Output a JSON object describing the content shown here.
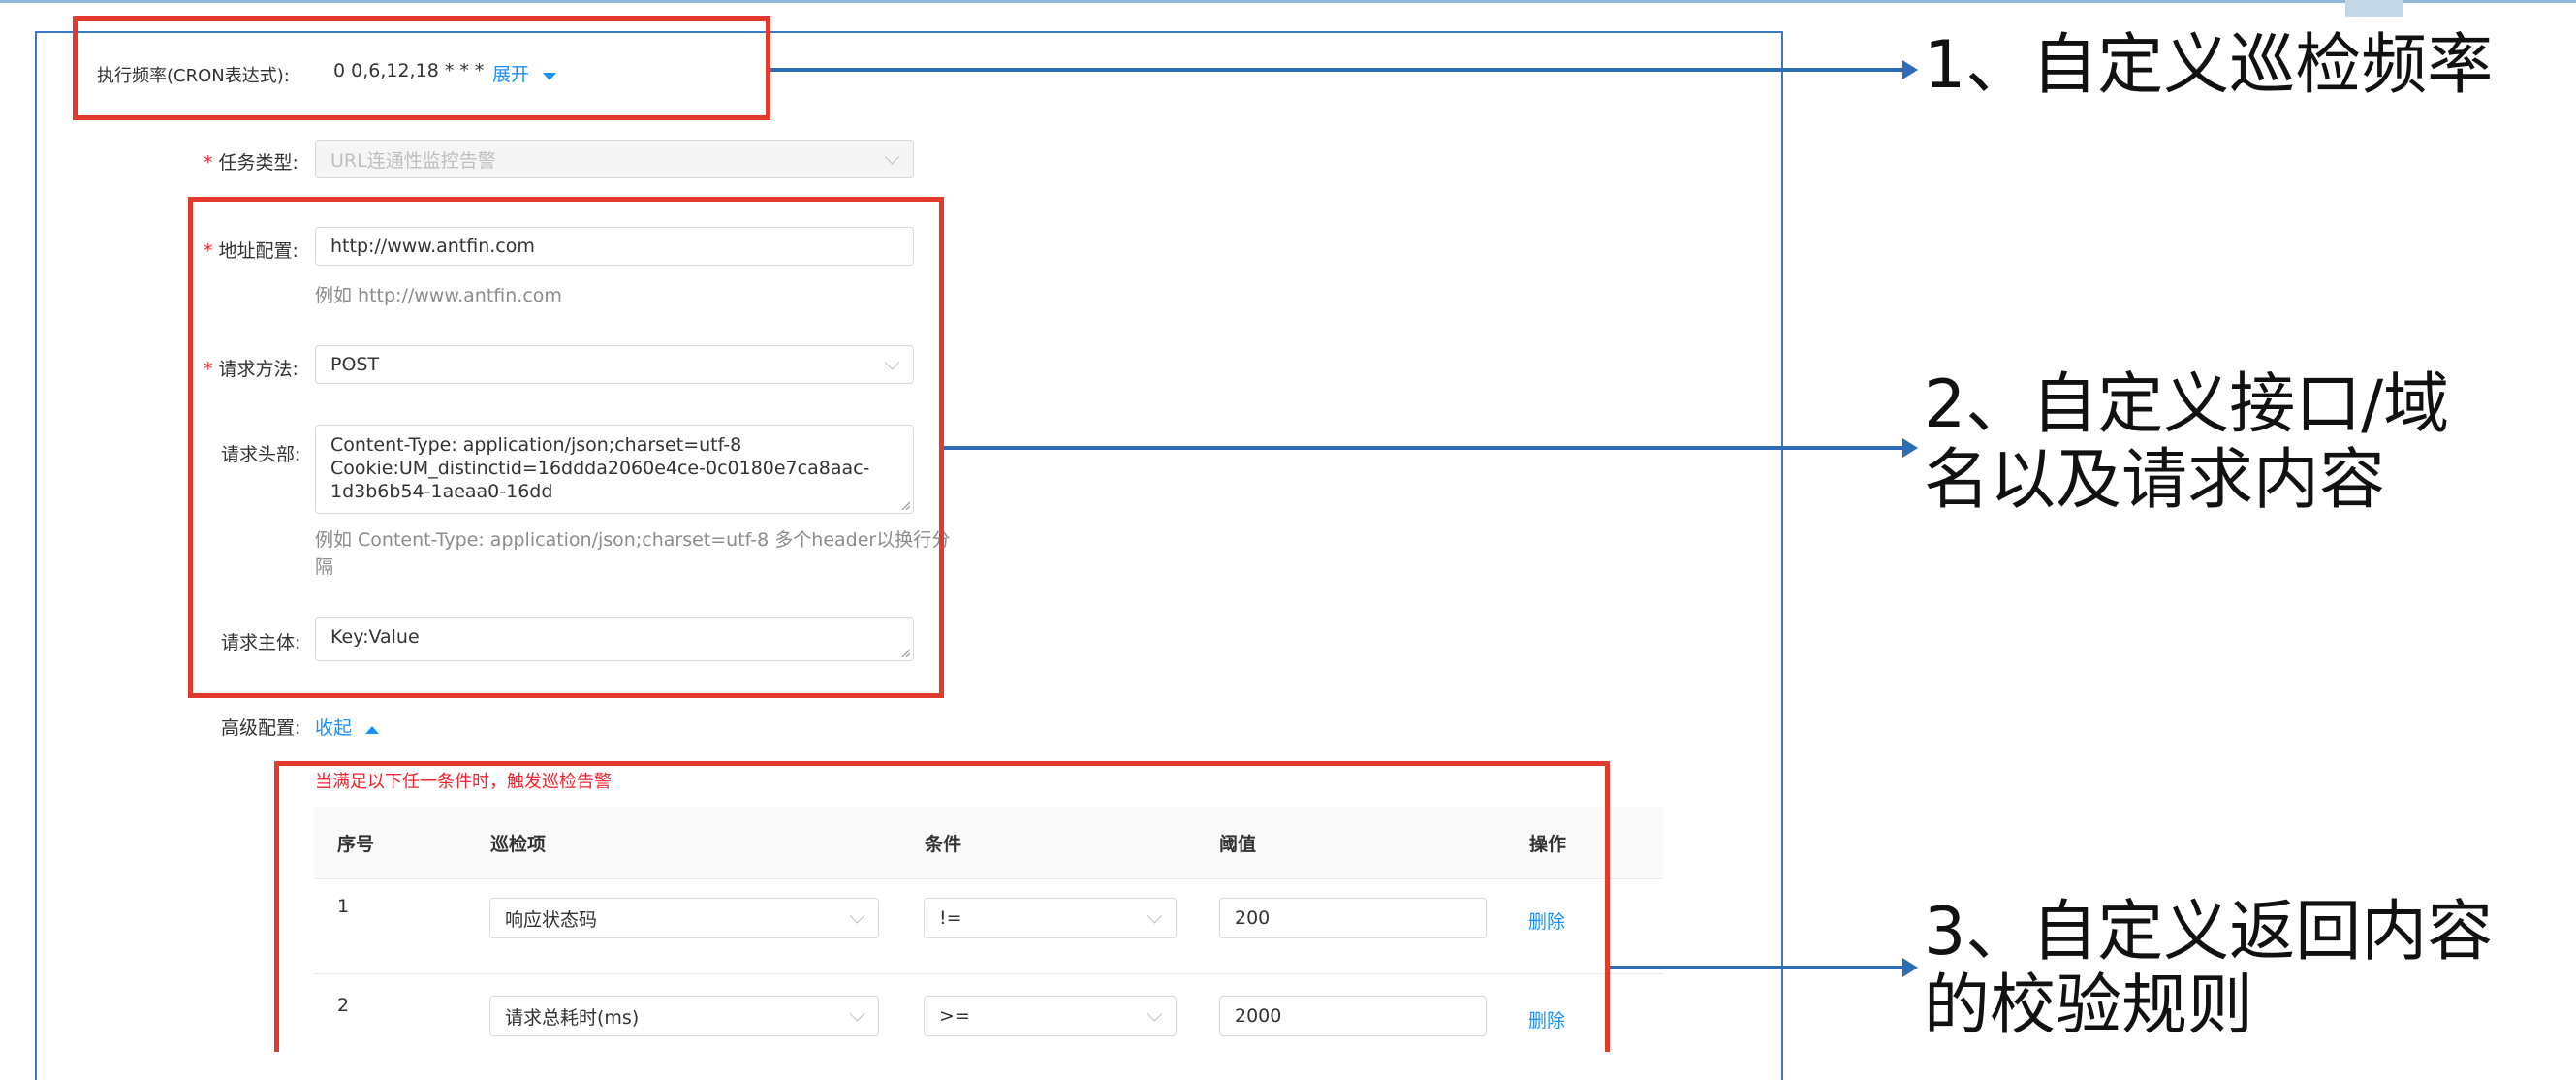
{
  "form": {
    "cron_label": "执行频率(CRON表达式):",
    "cron_value": "0 0,6,12,18 * * *",
    "cron_expand": "展开",
    "task_type": {
      "label": "任务类型:",
      "required": "*",
      "value": "URL连通性监控告警"
    },
    "address": {
      "label": "地址配置:",
      "required": "*",
      "value": "http://www.antfin.com",
      "hint": "例如 http://www.antfin.com"
    },
    "method": {
      "label": "请求方法:",
      "required": "*",
      "value": "POST"
    },
    "headers": {
      "label": "请求头部:",
      "line1": "Content-Type: application/json;charset=utf-8",
      "line2": "Cookie:UM_distinctid=16ddda2060e4ce-0c0180e7ca8aac-",
      "line3": "1d3b6b54-1aeaa0-16dd",
      "hint_line1": "例如 Content-Type: application/json;charset=utf-8 多个header以换行分",
      "hint_line2": "隔"
    },
    "body": {
      "label": "请求主体:",
      "value": "Key:Value"
    },
    "advanced": {
      "label": "高级配置:",
      "toggle": "收起"
    }
  },
  "rules": {
    "caption": "当满足以下任一条件时，触发巡检告警",
    "columns": [
      "序号",
      "巡检项",
      "条件",
      "阈值",
      "操作"
    ],
    "rows": [
      {
        "index": "1",
        "item": "响应状态码",
        "condition": "!=",
        "threshold": "200",
        "action": "删除"
      },
      {
        "index": "2",
        "item": "请求总耗时(ms)",
        "condition": ">=",
        "threshold": "2000",
        "action": "删除"
      }
    ]
  },
  "annotations": {
    "a1": "1、自定义巡检频率",
    "a2_line1": "2、自定义接口/域",
    "a2_line2": "名以及请求内容",
    "a3_line1": "3、自定义返回内容",
    "a3_line2": "的校验规则"
  },
  "colors": {
    "highlight_box": "#e23b2e",
    "arrow": "#2e6db6",
    "link": "#1890ff",
    "required": "#f5222d"
  },
  "icons": {
    "expand": "caret-down-icon",
    "collapse": "caret-up-icon",
    "select": "chevron-down-icon"
  }
}
